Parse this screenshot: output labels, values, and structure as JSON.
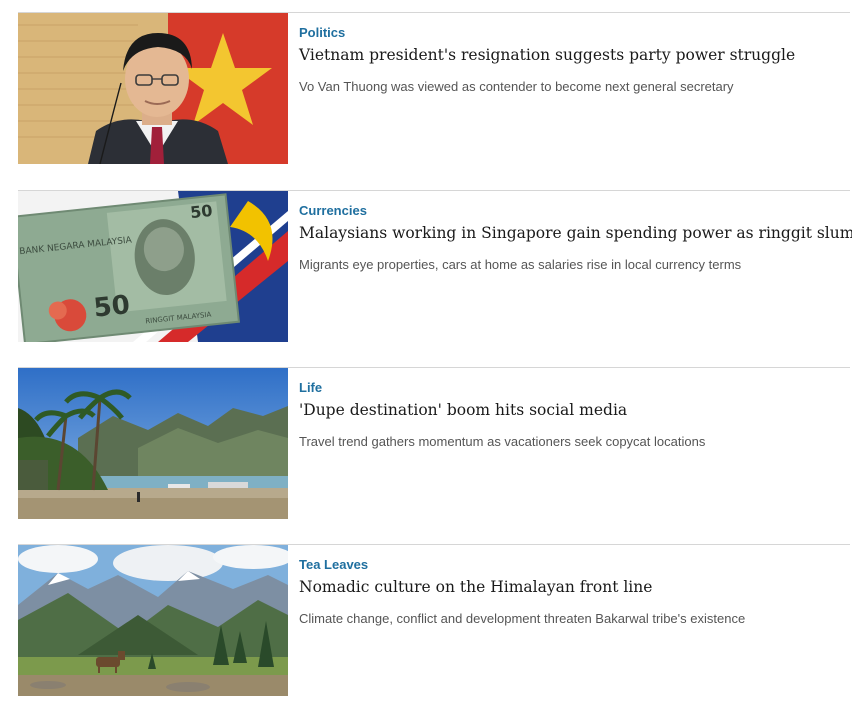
{
  "articles": [
    {
      "category": "Politics",
      "headline": "Vietnam president's resignation suggests party power struggle",
      "summary": "Vo Van Thuong was viewed as contender to become next general secretary",
      "image": "portrait-politician-photo"
    },
    {
      "category": "Currencies",
      "headline": "Malaysians working in Singapore gain spending power as ringgit slumps",
      "summary": "Migrants eye properties, cars at home as salaries rise in local currency terms",
      "image": "ringgit-banknote-photo",
      "image_text": {
        "bank": "BANK NEGARA MALAYSIA",
        "denomination": "50",
        "currency": "RINGGIT MALAYSIA"
      }
    },
    {
      "category": "Life",
      "headline": "'Dupe destination' boom hits social media",
      "summary": "Travel trend gathers momentum as vacationers seek copycat locations",
      "image": "tropical-beach-photo"
    },
    {
      "category": "Tea Leaves",
      "headline": "Nomadic culture on the Himalayan front line",
      "summary": "Climate change, conflict and development threaten Bakarwal tribe's existence",
      "image": "himalayan-valley-photo"
    }
  ]
}
